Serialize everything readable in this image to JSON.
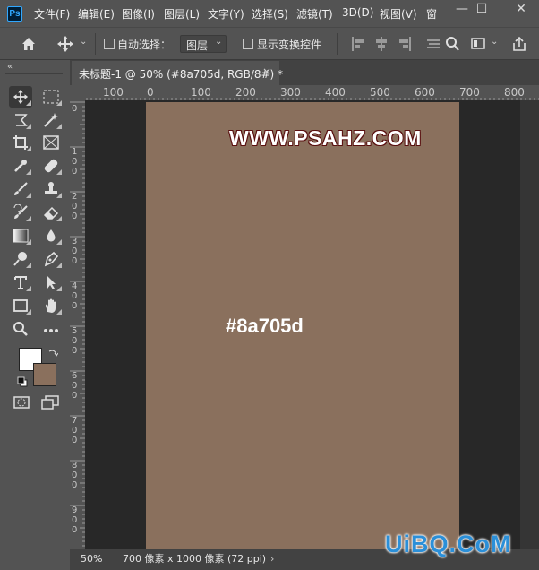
{
  "menu": {
    "logo": "Ps",
    "items": [
      "文件(F)",
      "编辑(E)",
      "图像(I)",
      "图层(L)",
      "文字(Y)",
      "选择(S)",
      "滤镜(T)",
      "3D(D)",
      "视图(V)",
      "窗"
    ],
    "window_controls": {
      "minimize": "—",
      "restore": "☐",
      "close": "✕"
    }
  },
  "options": {
    "auto_select_label": "自动选择：",
    "layer_value": "图层",
    "show_transform_label": "显示变换控件"
  },
  "document": {
    "tab_title": "未标题-1 @ 50% (#8a705d, RGB/8#) *",
    "tab_close": "×",
    "ruler_top": [
      "100",
      "0",
      "100",
      "200",
      "300",
      "400",
      "500",
      "600",
      "700",
      "800"
    ],
    "ruler_left": [
      "0",
      "100",
      "200",
      "300",
      "400",
      "500",
      "600",
      "700",
      "800",
      "900"
    ],
    "canvas_color": "#8a705d",
    "watermark_text": "WWW.PSAHZ.COM",
    "color_code_text": "#8a705d"
  },
  "status": {
    "zoom": "50%",
    "doc_info": "700 像素 x 1000 像素 (72 ppi)",
    "arrow": "›"
  },
  "site_logo": "UiBQ.CoM",
  "swatches": {
    "foreground": "#ffffff",
    "background": "#8a705d"
  }
}
